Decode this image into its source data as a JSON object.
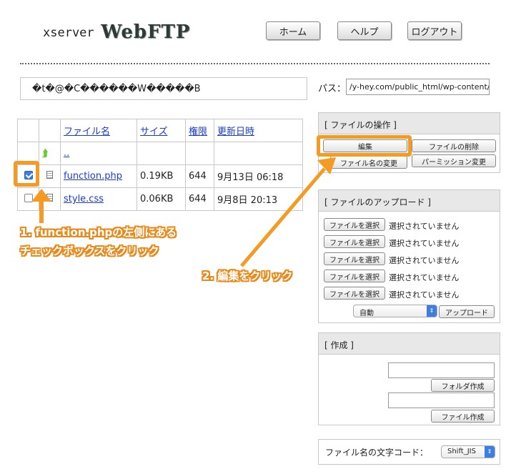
{
  "header": {
    "logo_small": "xserver",
    "logo_big": "WebFTP",
    "nav": [
      "ホーム",
      "ヘルプ",
      "ログアウト"
    ]
  },
  "message": "�t�@�C������W�����B",
  "path": {
    "label": "パス：",
    "value": "/y-hey.com/public_html/wp-content/t"
  },
  "file_table": {
    "headers": [
      "ファイル名",
      "サイズ",
      "権限",
      "更新日時"
    ],
    "parent": "..",
    "rows": [
      {
        "name": "function.php",
        "size": "0.19KB",
        "perm": "644",
        "date": "9月13日 06:18",
        "checked": true
      },
      {
        "name": "style.css",
        "size": "0.06KB",
        "perm": "644",
        "date": "9月8日 20:13",
        "checked": false
      }
    ]
  },
  "file_ops": {
    "title": "[ ファイルの操作 ]",
    "edit": "編集",
    "delete": "ファイルの削除",
    "rename": "ファイル名の変更",
    "permission": "パーミッション変更"
  },
  "upload": {
    "title": "[ ファイルのアップロード ]",
    "choose_label": "ファイルを選択",
    "no_file": "選択されていません",
    "mode": "自動",
    "upload_label": "アップロード"
  },
  "create": {
    "title": "[ 作成 ]",
    "folder_label": "フォルダ作成",
    "file_label": "ファイル作成"
  },
  "encoding": {
    "label": "ファイル名の文字コード：",
    "value": "Shift_JIS"
  },
  "annotations": {
    "step1_line1": "1. function.phpの左側にある",
    "step1_line2": "チェックボックスをクリック",
    "step2": "2. 編集をクリック",
    "color": "#f59a23"
  }
}
